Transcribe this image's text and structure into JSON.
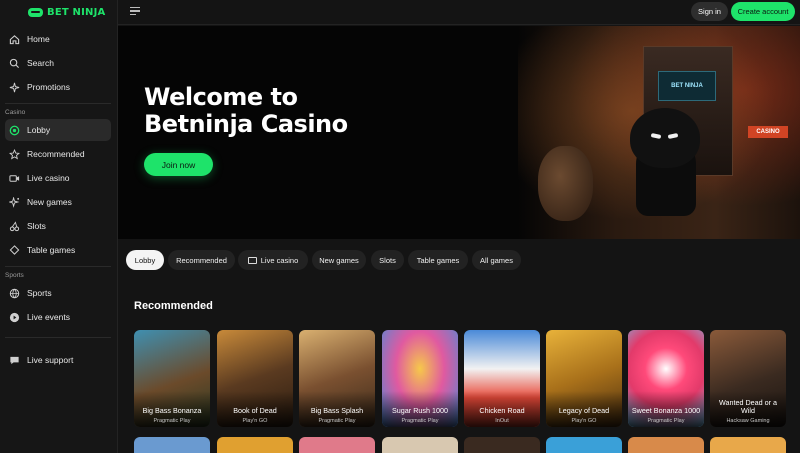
{
  "brand": {
    "name": "BET NINJA",
    "accent": "#1ee36a"
  },
  "sidebar": {
    "items": [
      {
        "label": "Home",
        "icon": "home-icon"
      },
      {
        "label": "Search",
        "icon": "search-icon"
      },
      {
        "label": "Promotions",
        "icon": "sparkle-icon"
      }
    ],
    "casino_section": "Casino",
    "casino_items": [
      {
        "label": "Lobby",
        "icon": "lobby-icon",
        "active": true
      },
      {
        "label": "Recommended",
        "icon": "star-icon"
      },
      {
        "label": "Live casino",
        "icon": "camera-icon"
      },
      {
        "label": "New games",
        "icon": "sparkle-icon"
      },
      {
        "label": "Slots",
        "icon": "cherry-icon"
      },
      {
        "label": "Table games",
        "icon": "cards-icon"
      }
    ],
    "sports_section": "Sports",
    "sports_items": [
      {
        "label": "Sports",
        "icon": "globe-icon"
      },
      {
        "label": "Live events",
        "icon": "play-icon"
      }
    ],
    "support": {
      "label": "Live support",
      "icon": "chat-icon"
    }
  },
  "topbar": {
    "sign_in": "Sign in",
    "create_account": "Create account"
  },
  "hero": {
    "title_line1": "Welcome to",
    "title_line2": "Betninja Casino",
    "cta": "Join now",
    "art_screen_text": "BET NINJA",
    "art_sign_text": "CASINO"
  },
  "tabs": [
    "Lobby",
    "Recommended",
    "Live casino",
    "New games",
    "Slots",
    "Table games",
    "All games"
  ],
  "section_title": "Recommended",
  "games": [
    {
      "name": "Big Bass Bonanza",
      "provider": "Pragmatic Play"
    },
    {
      "name": "Book of Dead",
      "provider": "Play'n GO"
    },
    {
      "name": "Big Bass Splash",
      "provider": "Pragmatic Play"
    },
    {
      "name": "Sugar Rush 1000",
      "provider": "Pragmatic Play"
    },
    {
      "name": "Chicken Road",
      "provider": "InOut"
    },
    {
      "name": "Legacy of Dead",
      "provider": "Play'n GO"
    },
    {
      "name": "Sweet Bonanza 1000",
      "provider": "Pragmatic Play"
    },
    {
      "name": "Wanted Dead or a Wild",
      "provider": "Hacksaw Gaming"
    }
  ]
}
